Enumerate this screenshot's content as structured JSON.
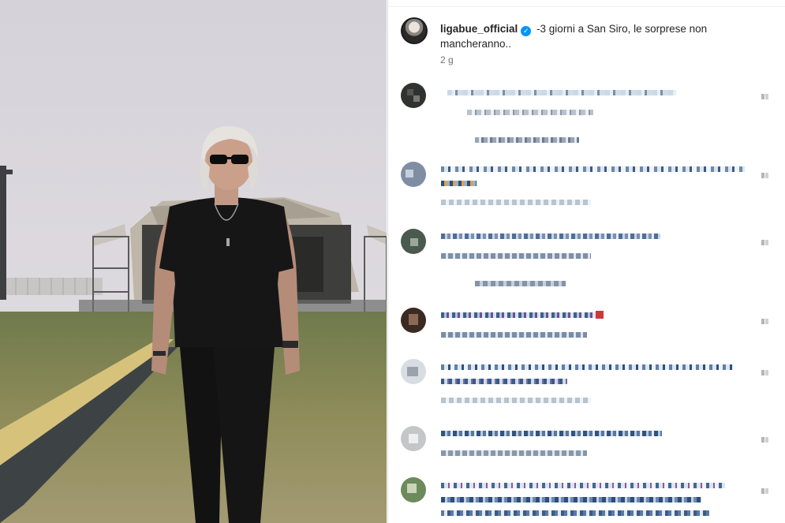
{
  "post": {
    "username": "ligabue_official",
    "verified_icon": "verified-badge-icon",
    "caption": "-3 giorni a San Siro, le sorprese non mancheranno..",
    "time_ago": "2 g"
  },
  "media": {
    "description_icon": "stadium-photo",
    "colors": {
      "sky": "#d9d6dc",
      "grass": "#8c8f58",
      "shirt": "#141414",
      "stage": "#b9b2a6"
    }
  },
  "comments_panel": {
    "pixelated": true,
    "comments": [
      {
        "name": "comment-1",
        "has_replies": true
      },
      {
        "name": "comment-2",
        "has_replies": false
      },
      {
        "name": "comment-3",
        "has_replies": true
      },
      {
        "name": "comment-4",
        "has_replies": false
      },
      {
        "name": "comment-5",
        "has_replies": false
      },
      {
        "name": "comment-6",
        "has_replies": false
      },
      {
        "name": "comment-7",
        "has_replies": false
      }
    ]
  }
}
